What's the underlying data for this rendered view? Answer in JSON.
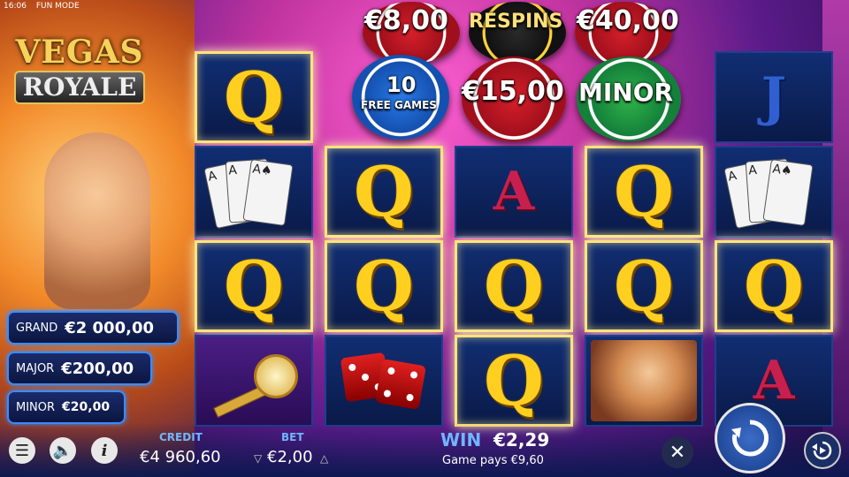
{
  "status_bar": {
    "time": "16:06",
    "mode": "FUN MODE"
  },
  "logo": {
    "line1": "VEGAS",
    "line2": "ROYALE"
  },
  "jackpots": [
    {
      "label": "GRAND",
      "value": "€2 000,00"
    },
    {
      "label": "MAJOR",
      "value": "€200,00"
    },
    {
      "label": "MINOR",
      "value": "€20,00"
    }
  ],
  "bonus_chips": {
    "top_left_value": "€8,00",
    "respins": "RESPINS",
    "top_right_value": "€40,00",
    "free_games_count": "10",
    "free_games_label": "FREE GAMES",
    "middle_value": "€15,00",
    "minor": "MINOR"
  },
  "reels": {
    "symbols": [
      [
        "Q",
        "cards",
        "Q",
        "key"
      ],
      [
        "",
        "Q",
        "Q",
        "dice"
      ],
      [
        "",
        "A",
        "Q",
        "Q"
      ],
      [
        "",
        "Q",
        "Q",
        "showgirl"
      ],
      [
        "J",
        "cards",
        "Q",
        "A"
      ]
    ]
  },
  "footer": {
    "credit_label": "CREDIT",
    "credit_value": "€4 960,60",
    "bet_label": "BET",
    "bet_value": "€2,00",
    "win_label": "WIN",
    "win_value": "€2,29",
    "game_pays": "Game pays €9,60"
  },
  "colors": {
    "accent_gold": "#ffcf1f",
    "jackpot_border": "#3a8dff",
    "label_blue": "#6fb6ff"
  }
}
